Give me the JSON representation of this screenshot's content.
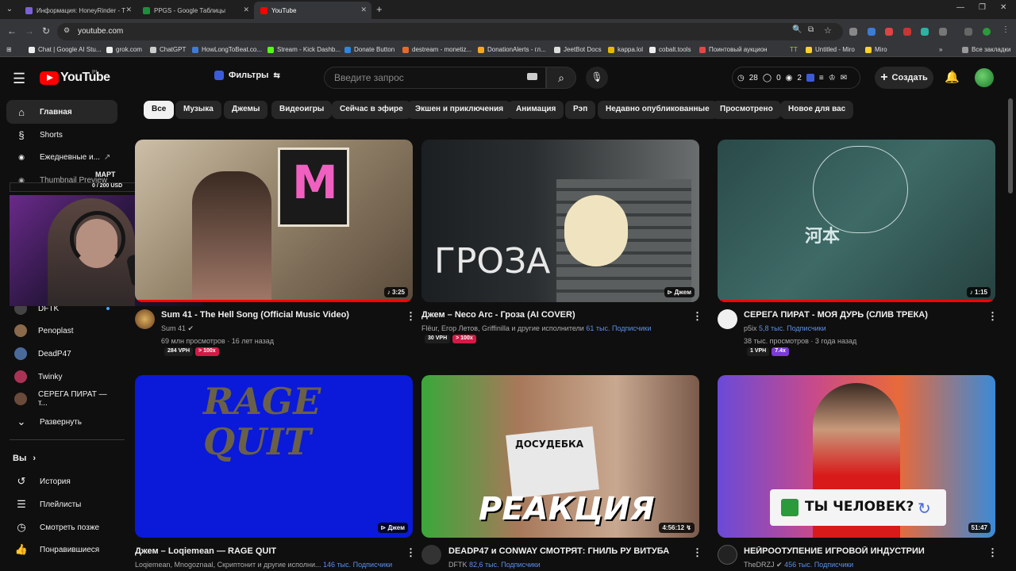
{
  "browser": {
    "tabs": [
      {
        "title": "Информация: HoneyRinder - T",
        "color": "#7b61d8"
      },
      {
        "title": "PPGS - Google Таблицы",
        "color": "#1e8e3e"
      },
      {
        "title": "YouTube",
        "color": "#ff0000"
      }
    ],
    "url": "youtube.com",
    "bookmarks": [
      {
        "label": "Chat | Google AI Stu...",
        "color": "#eeeeee"
      },
      {
        "label": "grok.com",
        "color": "#eeeeee"
      },
      {
        "label": "ChatGPT",
        "color": "#cccccc"
      },
      {
        "label": "HowLongToBeat.co...",
        "color": "#3d7bd8"
      },
      {
        "label": "Stream - Kick Dashb...",
        "color": "#53fc18"
      },
      {
        "label": "Donate Button",
        "color": "#2e86de"
      },
      {
        "label": "destream - monetiz...",
        "color": "#e66a2c"
      },
      {
        "label": "DonationAlerts - гл...",
        "color": "#f6a623"
      },
      {
        "label": "JeetBot Docs",
        "color": "#dddddd"
      },
      {
        "label": "kappa.lol",
        "color": "#e6b800"
      },
      {
        "label": "cobalt.tools",
        "color": "#eeeeee"
      },
      {
        "label": "Поинтовый аукцион",
        "color": "#e04848"
      },
      {
        "label": "TT",
        "color": "#9ad13a"
      },
      {
        "label": "Untitled - Miro",
        "color": "#ffd02f"
      },
      {
        "label": "Miro",
        "color": "#ffd02f"
      }
    ],
    "all_bookmarks": "Все закладки"
  },
  "masthead": {
    "logo": "YouTube",
    "country": "PL",
    "filters": "Фильтры",
    "search_placeholder": "Введите запрос",
    "stats": [
      "28",
      "0",
      "2"
    ],
    "create": "Создать"
  },
  "sidebar": {
    "main": [
      {
        "label": "Главная",
        "icon": "home-icon"
      },
      {
        "label": "Shorts",
        "icon": "shorts-icon"
      },
      {
        "label": "Ежедневные и...",
        "icon": "channel-icon"
      },
      {
        "label": "Thumbnail Preview",
        "icon": "channel-icon"
      }
    ],
    "channels": [
      {
        "label": "DFTK",
        "color": "#444"
      },
      {
        "label": "Penoplast",
        "color": "#8a6a4a"
      },
      {
        "label": "DeadP47",
        "color": "#4a6a9a"
      },
      {
        "label": "Twinky",
        "color": "#aa3355"
      },
      {
        "label": "СЕРЕГА ПИРАТ — т...",
        "color": "#6a4a3a"
      }
    ],
    "expand": "Развернуть",
    "you_header": "Вы",
    "you": [
      {
        "label": "История",
        "icon": "history-icon"
      },
      {
        "label": "Плейлисты",
        "icon": "playlists-icon"
      },
      {
        "label": "Смотреть позже",
        "icon": "watch-later-icon"
      },
      {
        "label": "Понравившиеся",
        "icon": "like-icon"
      }
    ]
  },
  "stream_overlay": {
    "goal_label": "МАРТ",
    "goal_amount": "0 / 200 USD",
    "goal_progress": 0.0
  },
  "chips": [
    "Все",
    "Музыка",
    "Джемы",
    "Видеоигры",
    "Сейчас в эфире",
    "Экшен и приключения",
    "Анимация",
    "Рэп",
    "Недавно опубликованные",
    "Просмотрено",
    "Новое для вас"
  ],
  "videos": [
    {
      "title": "Sum 41 - The Hell Song (Official Music Video)",
      "channel": "Sum 41",
      "meta": "69 млн просмотров · 16 лет назад",
      "subs": "",
      "duration": "3:25",
      "vph": "284 VPH",
      "badge": "> 100x",
      "badge_class": "b",
      "thumb_text": "M"
    },
    {
      "title": "Джем – Neco Arc - Гроза (AI COVER)",
      "channel": "Flëur, Егор Летов, Griffinilla и другие исполнители",
      "meta": "",
      "subs": "61 тыс. Подписчики",
      "duration": "Джем",
      "vph": "30 VPH",
      "badge": "> 100x",
      "badge_class": "b",
      "thumb_text": "ГРОЗА"
    },
    {
      "title": "СЕРЕГА ПИРАТ - МОЯ ДУРЬ (СЛИВ ТРЕКА)",
      "channel": "p5ix",
      "meta": "38 тыс. просмотров · 3 года назад",
      "subs": "5,8 тыс. Подписчики",
      "duration": "1:15",
      "vph": "1 VPH",
      "badge": "7.4x",
      "badge_class": "c",
      "thumb_text": "河本"
    },
    {
      "title": "Джем – Loqiemean — RAGE QUIT",
      "channel": "Loqiemean, Mnogoznaal, Скриптонит и другие исполни...",
      "meta": "",
      "subs": "146 тыс. Подписчики",
      "duration": "Джем",
      "vph": "",
      "badge": "",
      "badge_class": "",
      "thumb_text": "RAGE QUIT"
    },
    {
      "title": "DEADP47 и CONWAY СМОТРЯТ: ГНИЛЬ РУ ВИТУБА",
      "channel": "DFTK",
      "meta": "",
      "subs": "82,6 тыс. Подписчики",
      "duration": "4:56:12",
      "vph": "",
      "badge": "",
      "badge_class": "",
      "thumb_text": "РЕАКЦИЯ"
    },
    {
      "title": "НЕЙРООТУПЕНИЕ ИГРОВОЙ ИНДУСТРИИ",
      "channel": "TheDRZJ",
      "meta": "",
      "subs": "456 тыс. Подписчики",
      "duration": "51:47",
      "vph": "",
      "badge": "",
      "badge_class": "",
      "thumb_text": "ТЫ ЧЕЛОВЕК?"
    }
  ],
  "thumb_extra": {
    "dosye": "ДОСУДЕБКА"
  }
}
